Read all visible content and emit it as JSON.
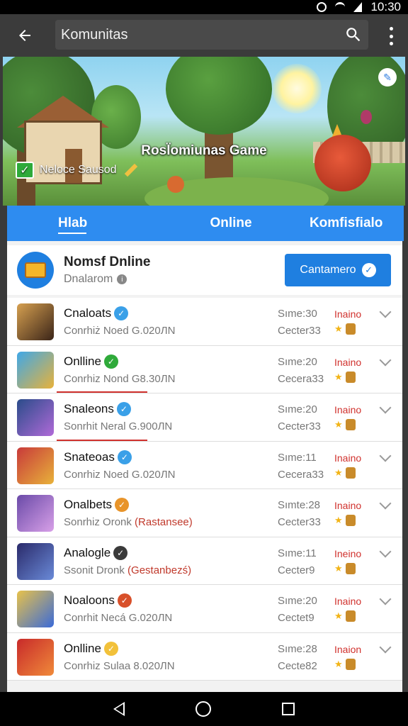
{
  "status_bar": {
    "time": "10:30"
  },
  "app_bar": {
    "search_value": "Komunitas"
  },
  "banner": {
    "title": "Rosl̈omiunas Game",
    "badge_text": "Neloce Sausod"
  },
  "tabs": [
    {
      "label": "Hlab"
    },
    {
      "label": "Online"
    },
    {
      "label": "Komfisfialo"
    }
  ],
  "header": {
    "name": "Nomsf Dnline",
    "subtitle": "Dnalarom",
    "button_label": "Cantamero"
  },
  "items": [
    {
      "name": "Cnaloats",
      "sub": "Conrhiż   Noed G.020ЛN",
      "extra": "",
      "time": "Sıme:30",
      "time2": "Cecter33",
      "status": "Inaino",
      "badge_color": "#3aa0e8",
      "thumb": "linear-gradient(135deg,#d6a050,#3a2418)"
    },
    {
      "name": "Onlline",
      "sub": "Conrhiz   Nond G8.30ЛN",
      "extra": "",
      "time": "Sıme:20",
      "time2": "Cecera33",
      "status": "Inaino",
      "badge_color": "#2faa3a",
      "thumb": "linear-gradient(135deg,#3fa8e8,#e8b23a)"
    },
    {
      "name": "Snaleons",
      "sub": "Sonrhit   Neral G.900ЛN",
      "extra": "",
      "time": "Sıme:20",
      "time2": "Cecter33",
      "status": "Inaino",
      "badge_color": "#3aa0e8",
      "thumb": "linear-gradient(135deg,#2a4c8a,#b06ad8)"
    },
    {
      "name": "Snateoas",
      "sub": "Conrhiz   Noed G.020ЛN",
      "extra": "",
      "time": "Sıme:11",
      "time2": "Cecera33",
      "status": "Inaino",
      "badge_color": "#3aa0e8",
      "thumb": "linear-gradient(135deg,#c83a3a,#e8b23a)"
    },
    {
      "name": "Onalbets",
      "sub": "Sonrhiz   Oronk",
      "extra": "(Rastansee)",
      "time": "Sımte:28",
      "time2": "Cecter33",
      "status": "Inaino",
      "badge_color": "#e8942a",
      "thumb": "linear-gradient(135deg,#6a4aa8,#d8a0e8)"
    },
    {
      "name": "Analogle",
      "sub": "Ssonit   Dronk",
      "extra": "(Gestanbezś)",
      "time": "Sıme:11",
      "time2": "Cecter9",
      "status": "Ineino",
      "badge_color": "#3a3a3a",
      "thumb": "linear-gradient(135deg,#2a2a6a,#6a8ad8)"
    },
    {
      "name": "Noaloons",
      "sub": "Conrhit   Necá G.020ЛN",
      "extra": "",
      "time": "Sıme:20",
      "time2": "Cectet9",
      "status": "Inaino",
      "badge_color": "#d8502a",
      "thumb": "linear-gradient(135deg,#e8c24a,#3a6ad8)"
    },
    {
      "name": "Onlline",
      "sub": "Conrhiz   Sulaa 8.020ЛN",
      "extra": "",
      "time": "Sıme:28",
      "time2": "Cecte82",
      "status": "Inaion",
      "badge_color": "#f2c13a",
      "thumb": "linear-gradient(135deg,#c82a2a,#f08a3a)"
    }
  ],
  "icons": {
    "back": "back-arrow-icon",
    "search": "search-icon",
    "more": "more-vert-icon",
    "check": "check-icon",
    "pencil": "pencil-icon",
    "edit": "edit-icon"
  }
}
